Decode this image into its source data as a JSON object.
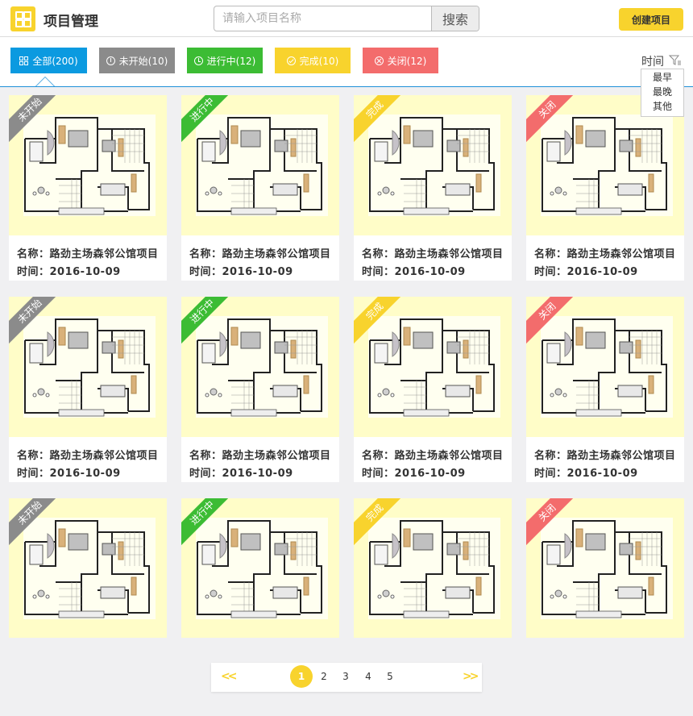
{
  "header": {
    "title": "项目管理",
    "search_placeholder": "请输入项目名称",
    "search_button": "搜索",
    "create_button": "创建项目"
  },
  "colors": {
    "accent_yellow": "#f8d32d",
    "tab_all": "#0b9ae0",
    "tab_not_started": "#8b8b8b",
    "tab_in_progress": "#3cbc34",
    "tab_done": "#f8d32d",
    "tab_closed": "#f36c6c",
    "divider_blue": "#1e90d8"
  },
  "filter_tabs": [
    {
      "label": "全部(200)",
      "icon": "grid-icon"
    },
    {
      "label": "未开始(10)",
      "icon": "info-circle-icon"
    },
    {
      "label": "进行中(12)",
      "icon": "clock-icon"
    },
    {
      "label": "完成(10)",
      "icon": "check-circle-icon"
    },
    {
      "label": "关闭(12)",
      "icon": "close-circle-icon"
    }
  ],
  "sort": {
    "label": "时间",
    "icon": "funnel-icon",
    "options": [
      "最早",
      "最晚",
      "其他"
    ]
  },
  "status_labels": [
    "未开始",
    "进行中",
    "完成",
    "关闭"
  ],
  "cards": [
    {
      "status": "未开始",
      "name": "名称：路劲主场森邻公馆项目",
      "time": "时间：2016-10-09"
    },
    {
      "status": "进行中",
      "name": "名称：路劲主场森邻公馆项目",
      "time": "时间：2016-10-09"
    },
    {
      "status": "完成",
      "name": "名称：路劲主场森邻公馆项目",
      "time": "时间：2016-10-09"
    },
    {
      "status": "关闭",
      "name": "名称：路劲主场森邻公馆项目",
      "time": "时间：2016-10-09"
    },
    {
      "status": "未开始",
      "name": "名称：路劲主场森邻公馆项目",
      "time": "时间：2016-10-09"
    },
    {
      "status": "进行中",
      "name": "名称：路劲主场森邻公馆项目",
      "time": "时间：2016-10-09"
    },
    {
      "status": "完成",
      "name": "名称：路劲主场森邻公馆项目",
      "time": "时间：2016-10-09"
    },
    {
      "status": "关闭",
      "name": "名称：路劲主场森邻公馆项目",
      "time": "时间：2016-10-09"
    },
    {
      "status": "未开始",
      "name": "",
      "time": ""
    },
    {
      "status": "进行中",
      "name": "",
      "time": ""
    },
    {
      "status": "完成",
      "name": "",
      "time": ""
    },
    {
      "status": "关闭",
      "name": "",
      "time": ""
    }
  ],
  "pagination": {
    "prev": "<<",
    "next": ">>",
    "pages": [
      "1",
      "2",
      "3",
      "4",
      "5"
    ],
    "current": "1"
  }
}
